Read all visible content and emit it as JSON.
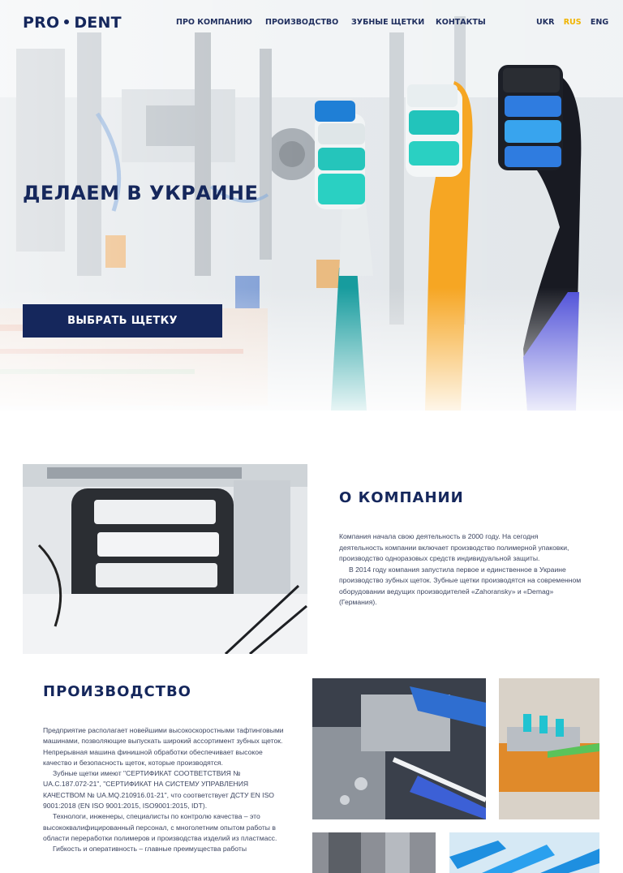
{
  "header": {
    "logo": {
      "left": "PRO",
      "right": "DENT"
    },
    "nav": [
      {
        "label": "ПРО КОМПАНИЮ"
      },
      {
        "label": "ПРОИЗВОДСТВО"
      },
      {
        "label": "ЗУБНЫЕ ЩЕТКИ"
      },
      {
        "label": "КОНТАКТЫ"
      }
    ],
    "languages": [
      {
        "label": "UKR",
        "active": false
      },
      {
        "label": "RUS",
        "active": true
      },
      {
        "label": "ENG",
        "active": false
      }
    ]
  },
  "hero": {
    "title": "ДЕЛАЕМ В УКРАИНЕ",
    "button_label": "ВЫБРАТЬ ЩЕТКУ"
  },
  "about": {
    "title": "О КОМПАНИИ",
    "paragraphs": [
      "Компания начала свою деятельность в 2000 году. На сегодня деятельность компании включает производство полимерной упаковки, производство одноразовых средств индивидуальной защиты.",
      "В 2014 году компания запустила первое и единственное в Украине производство зубных щеток. Зубные щетки производятся на современном оборудовании ведущих производителей «Zahoransky» и «Demag» (Германия)."
    ]
  },
  "production": {
    "title": "ПРОИЗВОДСТВО",
    "paragraphs": [
      "Предприятие располагает новейшими высокоскоростными тафтинговыми машинами, позволяющие выпускать широкий ассортимент зубных щеток. Непрерывная машина финишной обработки обеспечивает высокое качество и безопасность щеток, которые производятся.",
      "Зубные щетки имеют \"СЕРТИФИКАТ СООТВЕТСТВИЯ № UA.С.187.072-21\", \"СЕРТИФИКАТ НА СИСТЕМУ УПРАВЛЕНИЯ КАЧЕСТВОМ № UA.MQ.210916.01-21\", что соответствует ДСТУ EN ISO 9001:2018 (EN ISO 9001:2015, ISO9001:2015, IDT).",
      "Технологи, инженеры, специалисты по контролю качества – это высококвалифицированный персонал, с многолетним опытом работы в области переработки полимеров и производства изделий из пластмасс.",
      "Гибкость и оперативность – главные преимущества работы"
    ]
  },
  "colors": {
    "brand_navy": "#15275c",
    "active_language": "#f0b400"
  }
}
